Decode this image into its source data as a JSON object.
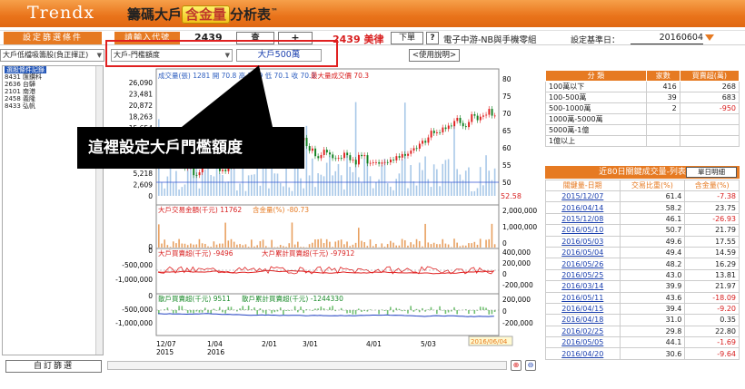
{
  "header": {
    "brand": "Trendx",
    "title_pre": "籌碼大戶",
    "title_hl": "含金量",
    "title_post": "分析表",
    "tm": "™"
  },
  "toolbar": {
    "filter_label": "設定篩選條件",
    "code_label": "請輸入代號",
    "code_value": "2439",
    "search_btn": "查",
    "plus_btn": "+",
    "stock_name": "2439 美律",
    "market_btn": "下單",
    "help_btn": "?",
    "industry": "電子中游-NB與手機零組",
    "base_date_label": "設定基準日：",
    "base_date_value": "20160604"
  },
  "subbar": {
    "left_select": "大戶低檔吸籌股(負正揮正)",
    "threshold_select": "大戶-門檻額度",
    "threshold_value": "大戶500萬",
    "usage_btn": "<使用說明>"
  },
  "left_list": {
    "header": "選股條件記錄",
    "items": [
      "8431 匯鑽科",
      "2636 台驊",
      "2101 南港",
      "2458 義隆",
      "8433 弘帆"
    ]
  },
  "custom_btn": "自訂篩選",
  "callout": "這裡設定大戶門檻額度",
  "chart_data": [
    {
      "type": "line",
      "title": "成交量(張) 1281  開 70.8  高 72.9  低 70.1  收 70.3",
      "title_alt": "最大量成交價 70.3",
      "x": [
        "12/07\n2015",
        "1/04\n2016",
        "2/01",
        "3/01",
        "4/01",
        "5/03"
      ],
      "left_ticks": [
        "26,090",
        "23,481",
        "20,872",
        "18,263",
        "15,654",
        "13,045",
        "10,436",
        "7,827",
        "5,218",
        "2,609",
        "0"
      ],
      "right_ticks": [
        "80",
        "75",
        "70",
        "65",
        "60",
        "55",
        "50"
      ],
      "last_price": "52.58",
      "close": [
        63,
        60,
        57,
        55,
        52,
        58,
        56,
        54,
        55,
        57,
        59,
        58,
        57,
        60,
        62,
        61,
        63,
        60,
        58,
        59,
        57,
        58,
        56,
        57,
        56,
        55,
        56,
        57,
        58,
        60,
        62,
        64,
        65,
        66,
        68,
        67,
        69,
        70,
        70.3
      ]
    },
    {
      "type": "bar",
      "title": "大戶交易金額(千元) 11762",
      "subtitle": "含金量(%) -80.73",
      "ticks": [
        "2,000,000",
        "1,000,000",
        "0"
      ]
    },
    {
      "type": "line",
      "title": "大戶買賣超(千元) -9496",
      "subtitle": "大戶累計買賣超(千元) -97912",
      "left_ticks": [
        "0",
        "-500,000",
        "-1,000,000"
      ],
      "right_ticks": [
        "400,000",
        "200,000",
        "0",
        "-200,000"
      ]
    },
    {
      "type": "line",
      "title": "散戶買賣超(千元) 9511",
      "subtitle": "散戶累計買賣超(千元) -1244330",
      "left_ticks": [
        "0",
        "-500,000",
        "-1,000,000"
      ],
      "right_ticks": [
        "200,000",
        "0",
        "-200,000"
      ],
      "date_label": "2016/06/04"
    }
  ],
  "table1": {
    "headers": [
      "分 類",
      "家數",
      "買賣超(萬)"
    ],
    "rows": [
      [
        "100萬以下",
        "416",
        "268"
      ],
      [
        "100-500萬",
        "39",
        "683"
      ],
      [
        "500-1000萬",
        "2",
        "-950"
      ],
      [
        "1000萬-5000萬",
        "",
        ""
      ],
      [
        "5000萬-1億",
        "",
        ""
      ],
      [
        "1億以上",
        "",
        ""
      ]
    ]
  },
  "table2": {
    "title": "近80日關鍵成交量-列表",
    "single_btn": "單日明細",
    "headers": [
      "關鍵量-日期",
      "交易比重(%)",
      "含金量(%)"
    ],
    "rows": [
      [
        "2015/12/07",
        "61.4",
        "-7.38"
      ],
      [
        "2016/04/14",
        "58.2",
        "23.75"
      ],
      [
        "2015/12/08",
        "46.1",
        "-26.93"
      ],
      [
        "2016/05/10",
        "50.7",
        "21.79"
      ],
      [
        "2016/05/03",
        "49.6",
        "17.55"
      ],
      [
        "2016/05/04",
        "49.4",
        "14.59"
      ],
      [
        "2016/05/26",
        "48.2",
        "16.29"
      ],
      [
        "2016/05/25",
        "43.0",
        "13.81"
      ],
      [
        "2016/03/14",
        "39.9",
        "21.97"
      ],
      [
        "2016/05/11",
        "43.6",
        "-18.09"
      ],
      [
        "2016/04/15",
        "39.4",
        "-9.20"
      ],
      [
        "2016/04/18",
        "31.0",
        "0.35"
      ],
      [
        "2016/02/25",
        "29.8",
        "22.80"
      ],
      [
        "2016/05/05",
        "44.1",
        "-1.69"
      ],
      [
        "2016/04/20",
        "30.6",
        "-9.64"
      ]
    ]
  },
  "colors": {
    "accent": "#e67a22",
    "negative": "#d81e1e",
    "link": "#1a3fae"
  }
}
